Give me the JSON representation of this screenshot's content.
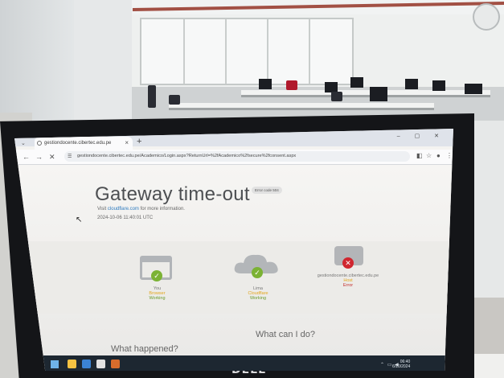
{
  "browser": {
    "tab_title": "gestiondocente.cibertec.edu.pe",
    "tab_close": "×",
    "new_tab": "+",
    "tab_dropdown": "⌄",
    "window_controls": "– ▢ ✕",
    "back": "←",
    "forward": "→",
    "reload": "✕",
    "url": "gestiondocente.cibertec.edu.pe/Academico/Login.aspx?ReturnUrl=%2fAcademico%2fsecure%2fconsent.aspx",
    "toolbar_icons": [
      "translate-icon",
      "star-icon",
      "profile-icon",
      "menu-icon"
    ]
  },
  "error_page": {
    "title": "Gateway time-out",
    "badge": "Error code 504",
    "visit_prefix": "Visit",
    "visit_link": "cloudflare.com",
    "visit_suffix": "for more information.",
    "timestamp": "2024-10-06 11:40:01 UTC",
    "nodes": [
      {
        "label1": "You",
        "label2": "Browser",
        "label3": "Working",
        "status": "ok"
      },
      {
        "label1": "Lima",
        "label2": "Cloudflare",
        "label3": "Working",
        "status": "ok"
      },
      {
        "label1": "gestiondocente.cibertec.edu.pe",
        "label2": "Host",
        "label3": "Error",
        "status": "error"
      }
    ],
    "what_can_i_do": "What can I do?",
    "what_happened": "What happened?"
  },
  "taskbar": {
    "time": "06:40",
    "date": "6/10/2024",
    "language": "ESP"
  },
  "monitor_brand": "DELL"
}
